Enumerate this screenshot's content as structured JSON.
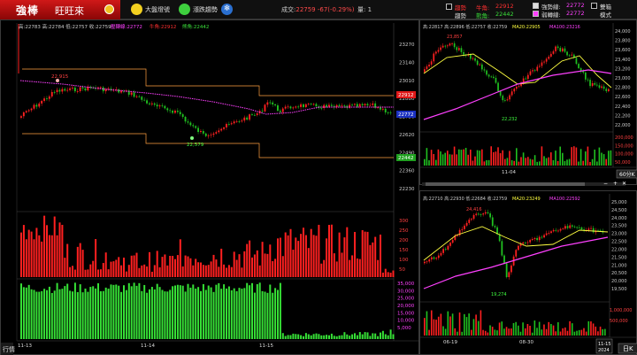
{
  "brand": {
    "name": "強棒",
    "app": "旺旺來"
  },
  "toolbar": {
    "market_signal_label": "大盤燈號",
    "updown_label": "漲跌趨勢",
    "snow_icon": "❄"
  },
  "trade": {
    "label": "成交:",
    "value": "22759 -67(-0.29%)",
    "volume_label": "量:",
    "volume_value": "1"
  },
  "legend": {
    "strong_weak_label": "趨勢",
    "trend_label": "趨勢",
    "bull_label": "牛角:",
    "bull_value": "22912",
    "bear_label": "熊角:",
    "bear_value": "22442",
    "strong_line_label": "強勢線:",
    "strong_line_value": "22772",
    "weak_line_label": "弱轉線:",
    "weak_line_value": "22772",
    "dual_label": "雙箱",
    "mode_label": "模式"
  },
  "colors": {
    "up": "#ff2020",
    "down": "#20c020",
    "vol_green": "#36e036",
    "ma20": "#ffff40",
    "ma100": "#ff40ff",
    "accent": "#d01818"
  },
  "left_chart": {
    "info": "高:22783 高:22784 低:22757 收:22759",
    "info_labels": {
      "ma": "壓轉線:22772",
      "bull": "牛角:22912",
      "bear": "熊角:22442"
    },
    "price_ticks": [
      "23270",
      "23140",
      "23010",
      "22880",
      "22750",
      "22620",
      "22490",
      "22360",
      "22230"
    ],
    "price_highlights": {
      "bull": "22912",
      "mid": "22772",
      "bear": "22442"
    },
    "annot_high": "22,915",
    "annot_low": "22,579",
    "vol_ticks_top": [
      "300",
      "250",
      "200",
      "150",
      "100",
      "50"
    ],
    "vol_ticks_bot": [
      "35,000",
      "30,000",
      "25,000",
      "20,000",
      "15,000",
      "10,000",
      "5,000"
    ],
    "dates": [
      "11-13",
      "11-14",
      "11-15"
    ],
    "side_tab": "行情"
  },
  "top_right": {
    "info": "高:22817 高:22896 低:22757 收:22759",
    "ma20_label": "MA20:22905",
    "ma100_label": "MA100:23216",
    "price_ticks": [
      "24,000",
      "23,800",
      "23,600",
      "23,400",
      "23,200",
      "23,000",
      "22,800",
      "22,600",
      "22,400",
      "22,200",
      "22,000"
    ],
    "vol_ticks": [
      "200,000",
      "150,000",
      "100,000",
      "50,000"
    ],
    "annot_high": "23,857",
    "annot_low": "22,232",
    "date": "11-04",
    "period": "60分K"
  },
  "bottom_right": {
    "info": "高:22710 高:22930 低:22684 收:22759",
    "ma20_label": "MA20:23249",
    "ma100_label": "MA100:22592",
    "price_ticks": [
      "25,000",
      "24,500",
      "24,000",
      "23,500",
      "23,000",
      "22,500",
      "22,000",
      "21,500",
      "21,000",
      "20,500",
      "20,000",
      "19,500"
    ],
    "vol_ticks": [
      "1,000,000",
      "500,000"
    ],
    "annot_high": "24,416",
    "annot_low": "19,274",
    "dates": [
      "06-19",
      "08-30"
    ],
    "current_date": "11-15 2024",
    "period": "日K"
  }
}
